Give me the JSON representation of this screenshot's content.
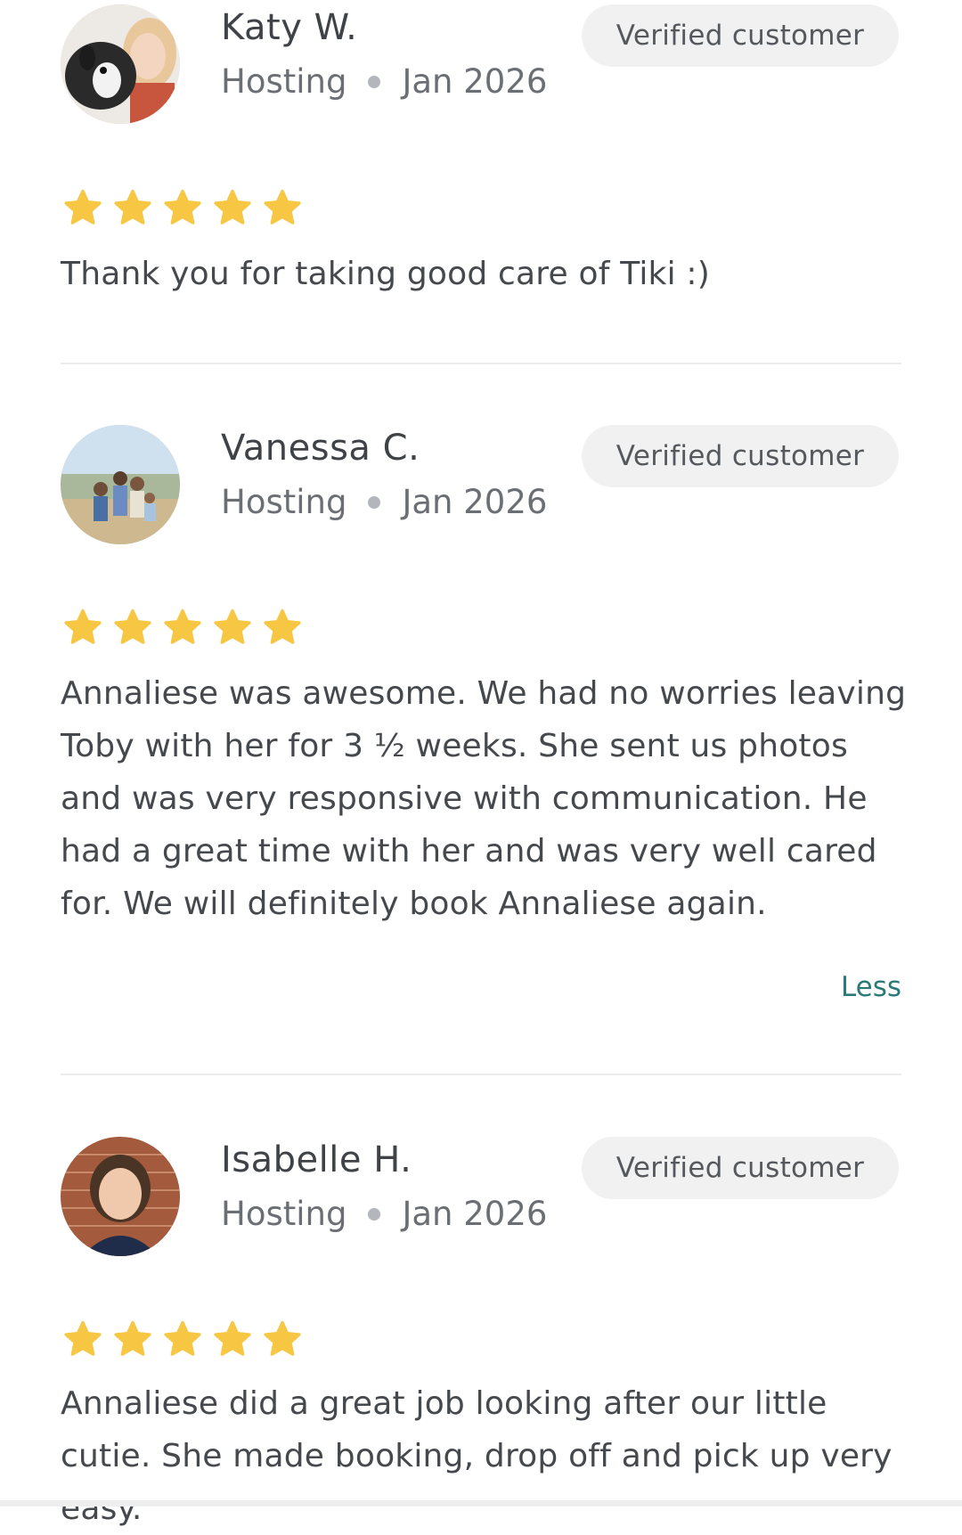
{
  "reviews": [
    {
      "name": "Katy W.",
      "service": "Hosting",
      "date": "Jan 2026",
      "badge": "Verified customer",
      "rating": 5,
      "text": "Thank you for taking good care of Tiki :)",
      "avatar_icon": "avatar-photo-woman-with-dog"
    },
    {
      "name": "Vanessa C.",
      "service": "Hosting",
      "date": "Jan 2026",
      "badge": "Verified customer",
      "rating": 5,
      "text": "Annaliese was awesome. We had no worries leaving Toby with her for 3 ½ weeks. She sent us photos and was very responsive with communication. He had a great time with her and was very well cared for. We will definitely book Annaliese again.",
      "toggle_label": "Less",
      "avatar_icon": "avatar-photo-family-on-beach"
    },
    {
      "name": "Isabelle H.",
      "service": "Hosting",
      "date": "Jan 2026",
      "badge": "Verified customer",
      "rating": 5,
      "text": "Annaliese did a great job looking after our little cutie. She made booking, drop off and pick up very easy.",
      "avatar_icon": "avatar-photo-woman-brick-wall"
    }
  ],
  "colors": {
    "star": "#F7C744",
    "link": "#2B7A78",
    "badge_bg": "#F1F1F1",
    "divider": "#ECECEC"
  }
}
